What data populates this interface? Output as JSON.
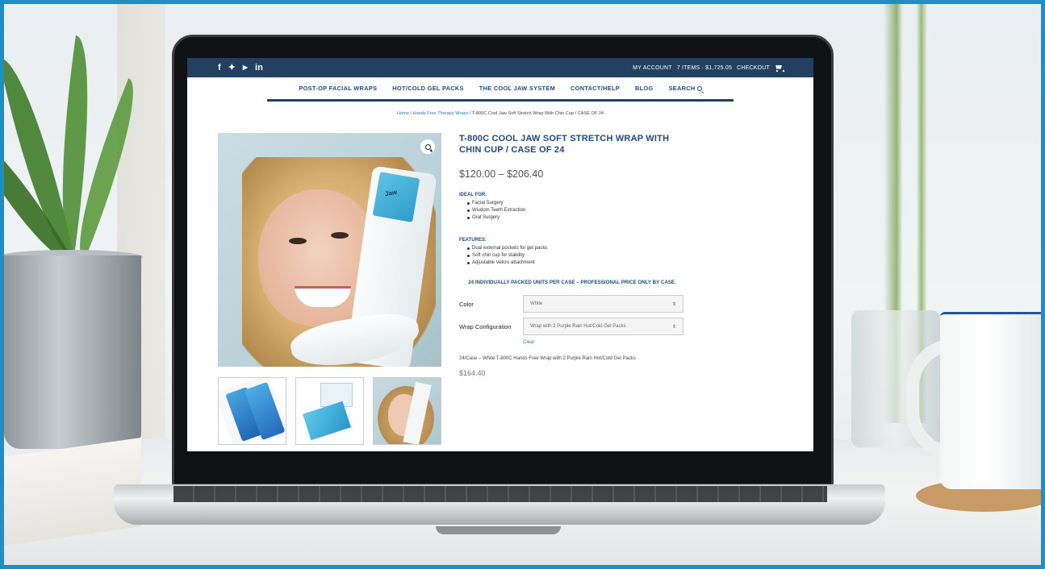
{
  "header": {
    "social": [
      "f",
      "▾",
      "You\nTube",
      "in"
    ],
    "my_account": "MY ACCOUNT",
    "cart_summary": "7 ITEMS · $1,725.05",
    "checkout": "CHECKOUT",
    "icons": [
      "facebook-icon",
      "twitter-icon",
      "youtube-icon",
      "linkedin-icon",
      "cart-icon"
    ],
    "bar_color": "#22405f"
  },
  "nav": {
    "items": [
      "POST-OP FACIAL WRAPS",
      "HOT/COLD GEL PACKS",
      "THE COOL JAW SYSTEM",
      "CONTACT/HELP",
      "BLOG",
      "SEARCH"
    ]
  },
  "breadcrumb": {
    "home": "Home",
    "category": "Hands Free Therapy Wraps",
    "current": "T-800C Cool Jaw Soft Stretch Wrap With Chin Cup / CASE OF 24"
  },
  "product": {
    "title": "T-800C COOL JAW SOFT STRETCH WRAP WITH CHIN CUP / CASE OF 24",
    "price_range": "$120.00 – $206.40",
    "ideal_for_heading": "IDEAL FOR:",
    "ideal_for": [
      "Facial Surgery",
      "Wisdom Teeth Extraction",
      "Oral Surgery"
    ],
    "features_heading": "FEATURES:",
    "features": [
      "Dual external pockets for gel packs",
      "Soft chin cup for stability",
      "Adjustable Velcro attachment"
    ],
    "note": "24 INDIVIDUALLY PACKED UNITS PER CASE – PROFESSIONAL PRICE ONLY BY CASE.",
    "color_label": "Color",
    "color_value": "White",
    "wrap_label": "Wrap Configuration",
    "wrap_value": "Wrap with 2 Purple Rain Hot/Cold Gel Packs",
    "clear": "Clear",
    "selected_desc": "24/Case – White T-800C Hands Free Wrap with 2 Purple Rain Hot/Cold Gel Packs",
    "selected_price": "$164.40",
    "gel_pack_logo": "Jaw",
    "accent_color": "#1f4a7a",
    "link_color": "#2f79b7"
  }
}
